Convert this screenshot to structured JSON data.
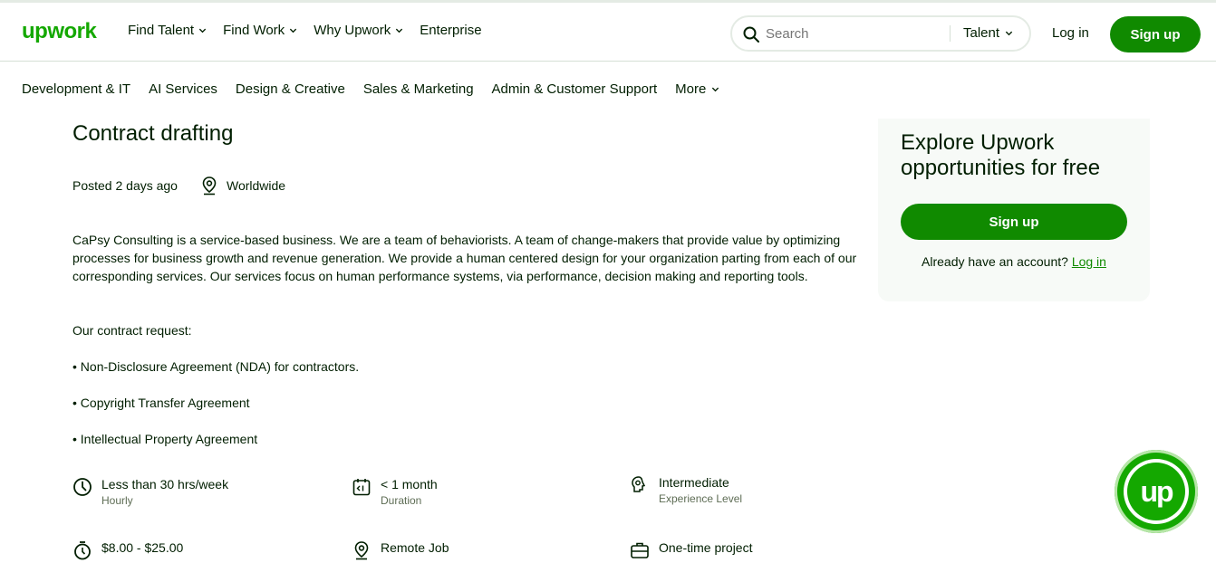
{
  "header": {
    "logo": "upwork",
    "nav": [
      {
        "label": "Find Talent"
      },
      {
        "label": "Find Work"
      },
      {
        "label": "Why Upwork"
      },
      {
        "label": "Enterprise"
      }
    ],
    "search": {
      "placeholder": "Search",
      "type": "Talent"
    },
    "login": "Log in",
    "signup": "Sign up"
  },
  "categories": [
    {
      "label": "Development & IT"
    },
    {
      "label": "AI Services"
    },
    {
      "label": "Design & Creative"
    },
    {
      "label": "Sales & Marketing"
    },
    {
      "label": "Admin & Customer Support"
    },
    {
      "label": "More"
    }
  ],
  "job": {
    "title": "Contract drafting",
    "posted": "Posted 2 days ago",
    "location": "Worldwide",
    "description": "CaPsy Consulting is a service-based business. We are a team of behaviorists. A team of change-makers that provide value by optimizing processes for business growth and revenue generation. We provide a human centered design for your organization parting from each of our corresponding services. Our services focus on human performance systems, via performance, decision making and reporting tools.",
    "request_intro": "Our contract request:",
    "items": [
      "• Non-Disclosure Agreement (NDA) for contractors.",
      "• Copyright Transfer Agreement",
      "• Intellectual Property Agreement"
    ],
    "features": [
      {
        "icon": "clock-icon",
        "value": "Less than 30 hrs/week",
        "label": "Hourly"
      },
      {
        "icon": "calendar-icon",
        "value": "< 1 month",
        "label": "Duration"
      },
      {
        "icon": "gear-brain-icon",
        "value": "Intermediate",
        "label": "Experience Level"
      },
      {
        "icon": "stopwatch-icon",
        "value": "$8.00 - $25.00",
        "label": ""
      },
      {
        "icon": "location-pin-icon",
        "value": "Remote Job",
        "label": ""
      },
      {
        "icon": "briefcase-icon",
        "value": "One-time project",
        "label": ""
      }
    ]
  },
  "sidebar": {
    "title": "Explore Upwork opportunities for free",
    "signup": "Sign up",
    "account_text": "Already have an account?",
    "login": "Log in"
  },
  "fab": {
    "label": "up"
  },
  "colors": {
    "brand": "#14a800",
    "button": "#108a00",
    "text": "#001e00"
  }
}
